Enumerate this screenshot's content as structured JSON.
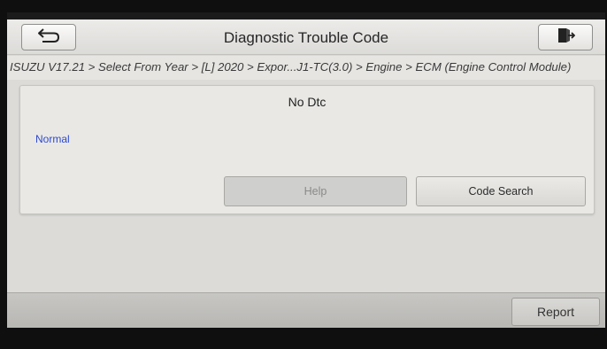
{
  "header": {
    "title": "Diagnostic Trouble Code",
    "back_icon": "back-arrow-icon",
    "exit_icon": "exit-door-icon"
  },
  "breadcrumb": "ISUZU V17.21 > Select From Year > [L] 2020 > Expor...J1-TC(3.0) > Engine > ECM (Engine Control Module)",
  "panel": {
    "heading": "No Dtc",
    "status": "Normal",
    "help_label": "Help",
    "code_search_label": "Code Search"
  },
  "footer": {
    "report_label": "Report"
  },
  "colors": {
    "status_text": "#2e4ad0",
    "disabled_button": "#cfcfcd"
  }
}
